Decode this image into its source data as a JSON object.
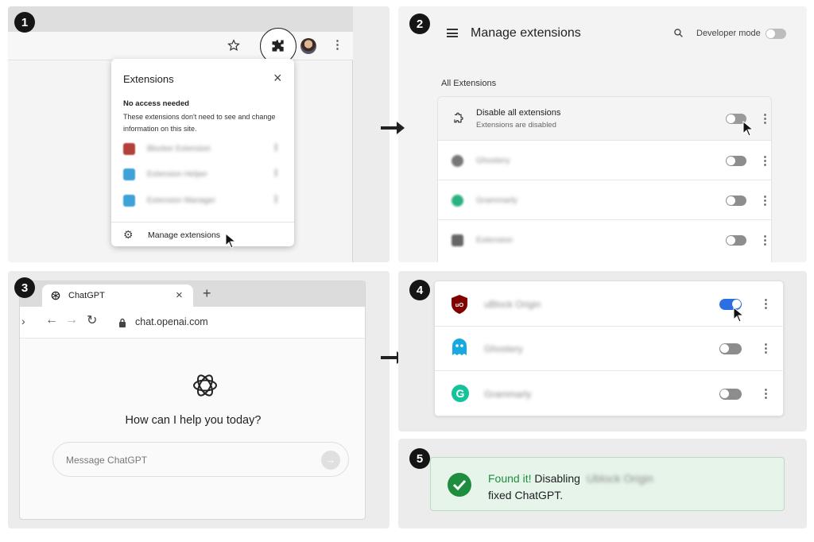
{
  "steps": {
    "s1": "1",
    "s2": "2",
    "s3": "3",
    "s4": "4",
    "s5": "5"
  },
  "popup": {
    "title": "Extensions",
    "section_title": "No access needed",
    "section_desc": "These extensions don't need to see and change information on this site.",
    "items": [
      {
        "name": "Blocker Extension",
        "color": "#b3413a"
      },
      {
        "name": "Extension Helper",
        "color": "#3ea1d8"
      },
      {
        "name": "Extension Manager",
        "color": "#3ea1d8"
      }
    ],
    "manage_label": "Manage extensions"
  },
  "manage": {
    "title": "Manage extensions",
    "dev_mode_label": "Developer mode",
    "section_label": "All Extensions",
    "disable_all": {
      "title": "Disable all extensions",
      "subtitle": "Extensions are disabled"
    },
    "rows": [
      {
        "name": "Ghostery"
      },
      {
        "name": "Grammarly"
      },
      {
        "name": "Extension"
      }
    ]
  },
  "browser": {
    "tab_title": "ChatGPT",
    "new_tab_symbol": "+",
    "close_symbol": "×",
    "url": "chat.openai.com",
    "heading": "How can I help you today?",
    "input_placeholder": "Message ChatGPT"
  },
  "ext_list": {
    "rows": [
      {
        "name": "uBlock Origin",
        "enabled": true,
        "icon": "ublock-icon",
        "color": "#800000"
      },
      {
        "name": "Ghostery",
        "enabled": false,
        "icon": "ghost-icon",
        "color": "#19a8e0"
      },
      {
        "name": "Grammarly",
        "enabled": false,
        "icon": "grammarly-icon",
        "color": "#15c39a"
      }
    ]
  },
  "result": {
    "found": "Found it!",
    "disabling": " Disabling",
    "ext_name": "Ublock Origin",
    "fixed": "fixed ChatGPT."
  },
  "colors": {
    "accent": "#2d6fe3",
    "success": "#1e8e3e",
    "success_bg": "#e6f4ea"
  }
}
